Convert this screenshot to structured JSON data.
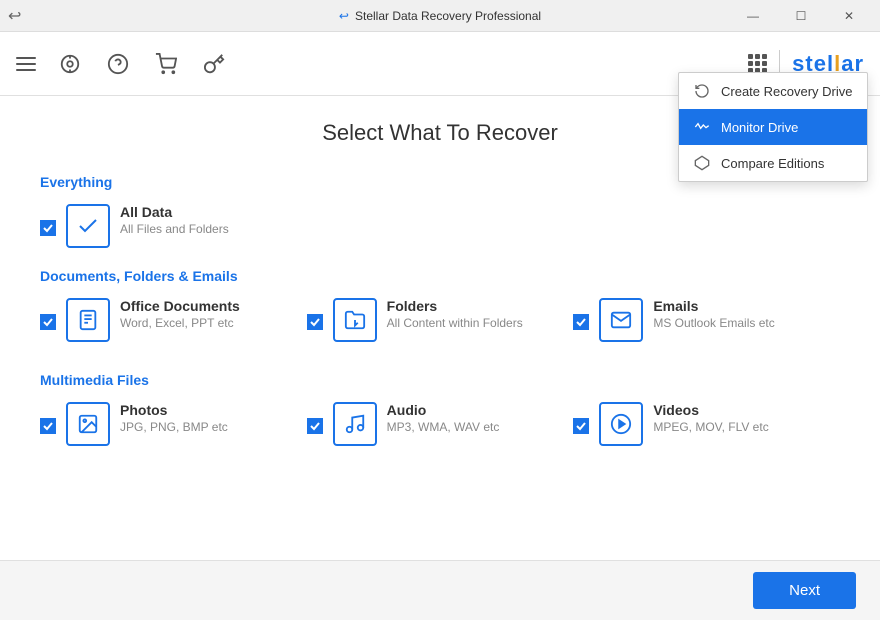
{
  "titleBar": {
    "icon": "↩",
    "title": "Stellar Data Recovery Professional",
    "minBtn": "—",
    "maxBtn": "☐",
    "closeBtn": "✕"
  },
  "toolbar": {
    "icons": [
      "hamburger",
      "monitor",
      "help",
      "cart",
      "key"
    ],
    "logoText": "stel",
    "logoHighlight": "lar"
  },
  "page": {
    "title": "Select What To Recover"
  },
  "sections": [
    {
      "id": "everything",
      "label": "Everything",
      "items": [
        {
          "name": "All Data",
          "desc": "All Files and Folders",
          "icon": "check",
          "checked": true
        }
      ]
    },
    {
      "id": "documents",
      "label": "Documents, Folders & Emails",
      "items": [
        {
          "name": "Office Documents",
          "desc": "Word, Excel, PPT etc",
          "icon": "doc",
          "checked": true
        },
        {
          "name": "Folders",
          "desc": "All Content within Folders",
          "icon": "folder",
          "checked": true
        },
        {
          "name": "Emails",
          "desc": "MS Outlook Emails etc",
          "icon": "email",
          "checked": true
        }
      ]
    },
    {
      "id": "multimedia",
      "label": "Multimedia Files",
      "items": [
        {
          "name": "Photos",
          "desc": "JPG, PNG, BMP etc",
          "icon": "photo",
          "checked": true
        },
        {
          "name": "Audio",
          "desc": "MP3, WMA, WAV etc",
          "icon": "audio",
          "checked": true
        },
        {
          "name": "Videos",
          "desc": "MPEG, MOV, FLV etc",
          "icon": "video",
          "checked": true
        }
      ]
    }
  ],
  "footer": {
    "nextLabel": "Next"
  },
  "dropdown": {
    "items": [
      {
        "id": "recovery-drive",
        "label": "Create Recovery Drive",
        "icon": "recovery"
      },
      {
        "id": "monitor-drive",
        "label": "Monitor Drive",
        "icon": "monitor-wave",
        "active": true
      },
      {
        "id": "compare-editions",
        "label": "Compare Editions",
        "icon": "diamond"
      }
    ]
  }
}
